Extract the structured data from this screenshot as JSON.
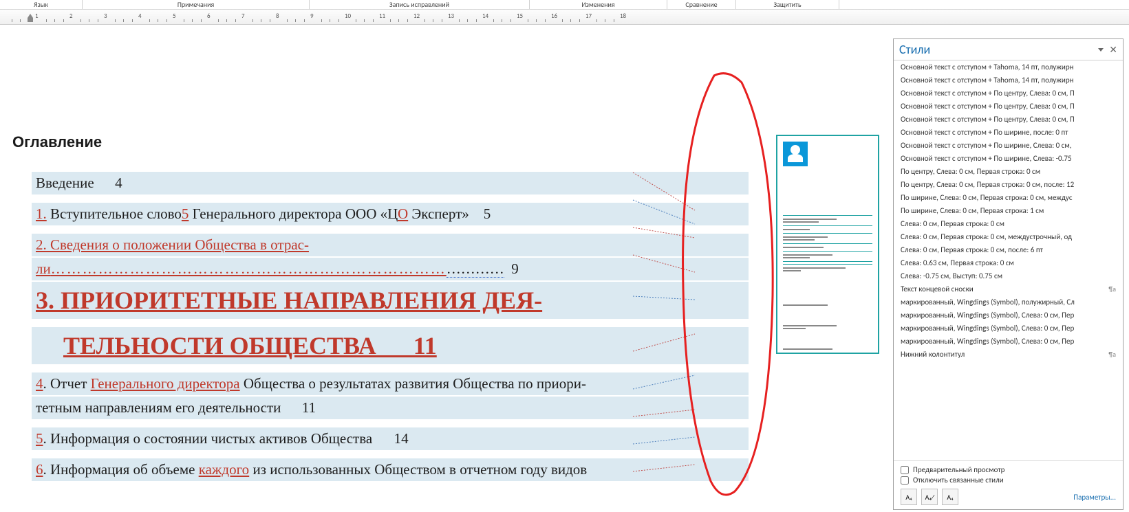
{
  "ribbon": {
    "lang": "Язык",
    "notes": "Примечания",
    "track": "Запись исправлений",
    "changes": "Изменения",
    "compare": "Сравнение",
    "protect": "Защитить"
  },
  "ruler_numbers": [
    1,
    2,
    3,
    4,
    5,
    6,
    7,
    8,
    9,
    10,
    11,
    12,
    13,
    14,
    15,
    16,
    17,
    18
  ],
  "doc": {
    "title": "Оглавление",
    "toc": [
      {
        "pre": "",
        "text": "Введение",
        "page": "4",
        "type": "plain"
      },
      {
        "numred": "1.",
        "text": " Вступительное слово",
        "mid_red": "5",
        "text2": " Генерального директора ООО «Ц",
        "mid_red2": "О",
        "text3": " Эксперт»",
        "page": "5",
        "type": "mixed"
      },
      {
        "numred": "2.",
        "textred": " Сведения о положении Общества в отрас-",
        "type": "red-only"
      },
      {
        "textred": "ли",
        "dots": "…………………………………………………………………",
        "dots_wavy": "…………",
        "page": "9",
        "type": "red-dots"
      },
      {
        "numred": "3.",
        "big": " ПРИОРИТЕТНЫЕ НАПРАВЛЕНИЯ ДЕЯ-",
        "type": "big"
      },
      {
        "big2": "ТЕЛЬНОСТИ ОБЩЕСТВА",
        "page": "11",
        "type": "big2"
      },
      {
        "numred": "4",
        "dot": ".",
        "text": " Отчет ",
        "textred": "Генерального директора",
        "text2": " Общества о результатах развития Общества по приори-",
        "type": "mixed2"
      },
      {
        "text": "тетным направлениям его деятельности",
        "page": "11",
        "type": "plain"
      },
      {
        "numred": "5",
        "dot": ".",
        "text": " Информация о состоянии чистых активов Общества",
        "page": "14",
        "type": "num"
      },
      {
        "numred": "6",
        "dot": ".",
        "text": " Информация об объеме ",
        "textred": "каждого",
        "text2": " из использованных Обществом в отчетном году видов",
        "type": "mixed2"
      }
    ]
  },
  "styles": {
    "title": "Стили",
    "items": [
      "Основной текст с отступом + Tahoma, 14 пт, полужирн",
      "Основной текст с отступом + Tahoma, 14 пт, полужирн",
      "Основной текст с отступом + По центру, Слева:  0 см, П",
      "Основной текст с отступом + По центру, Слева:  0 см, П",
      "Основной текст с отступом + По центру, Слева:  0 см, П",
      "Основной текст с отступом + По ширине, после: 0 пт",
      "Основной текст с отступом + По ширине, Слева:  0 см,",
      "Основной текст с отступом + По ширине, Слева:  -0.75",
      "По центру, Слева:  0 см, Первая строка:  0 см",
      "По центру, Слева:  0 см, Первая строка:  0 см, после: 12",
      "По ширине, Слева:  0 см, Первая строка:  0 см, междус",
      "По ширине, Слева:  0 см, Первая строка:  1 см",
      "Слева:  0 см, Первая строка:  0 см",
      "Слева:  0 см, Первая строка:  0 см, междустрочный,  од",
      "Слева:  0 см, Первая строка:  0 см, после: 6 пт",
      "Слева:  0.63 см, Первая строка:  0 см",
      "Слева:  -0.75 см, Выступ:  0.75 см",
      "Текст концевой сноски",
      "маркированный, Wingdings (Symbol), полужирный, Сл",
      "маркированный, Wingdings (Symbol), Слева:  0 см, Пер",
      "маркированный, Wingdings (Symbol), Слева:  0 см, Пер",
      "маркированный, Wingdings (Symbol), Слева:  0 см, Пер",
      "Нижний колонтитул"
    ],
    "pilcrow_indices": [
      17,
      22
    ],
    "preview_chk": "Предварительный просмотр",
    "linked_chk": "Отключить связанные стили",
    "btn1": "A₄",
    "btn2": "A₄⁄",
    "btn3": "A₄",
    "params": "Параметры..."
  }
}
